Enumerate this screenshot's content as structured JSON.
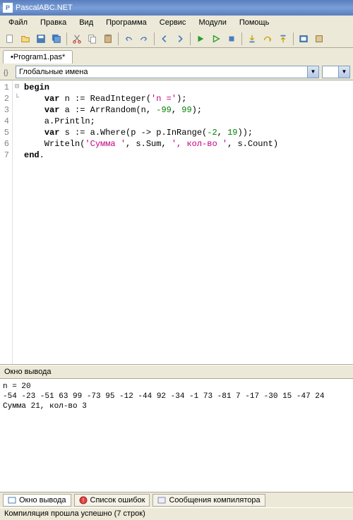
{
  "title": "PascalABC.NET",
  "menu": [
    "Файл",
    "Правка",
    "Вид",
    "Программа",
    "Сервис",
    "Модули",
    "Помощь"
  ],
  "tab": "•Program1.pas*",
  "combo_label": "Глобальные имена",
  "gutter": [
    "1",
    "2",
    "3",
    "4",
    "5",
    "6",
    "7"
  ],
  "fold": [
    "⊟",
    "",
    "",
    "",
    "",
    "",
    "└"
  ],
  "code": {
    "l1a": "begin",
    "l2a": "    ",
    "l2b": "var",
    "l2c": " n := ReadInteger(",
    "l2d": "'n ='",
    "l2e": ");",
    "l3a": "    ",
    "l3b": "var",
    "l3c": " a := ArrRandom(n, ",
    "l3d": "-99",
    "l3e": ", ",
    "l3f": "99",
    "l3g": ");",
    "l4a": "    a.Println;",
    "l5a": "    ",
    "l5b": "var",
    "l5c": " s := a.Where(p -> p.InRange(",
    "l5d": "-2",
    "l5e": ", ",
    "l5f": "19",
    "l5g": "));",
    "l6a": "    Writeln(",
    "l6b": "'Сумма '",
    "l6c": ", s.Sum, ",
    "l6d": "', кол-во '",
    "l6e": ", s.Count)",
    "l7a": "end",
    "l7b": "."
  },
  "output_header": "Окно вывода",
  "output_text": "n = 20\n-54 -23 -51 63 99 -73 95 -12 -44 92 -34 -1 73 -81 7 -17 -30 15 -47 24\nСумма 21, кол-во 3",
  "bottom_tabs": {
    "output": "Окно вывода",
    "errors": "Список ошибок",
    "compiler": "Сообщения компилятора"
  },
  "status": "Компиляция прошла успешно (7 строк)"
}
